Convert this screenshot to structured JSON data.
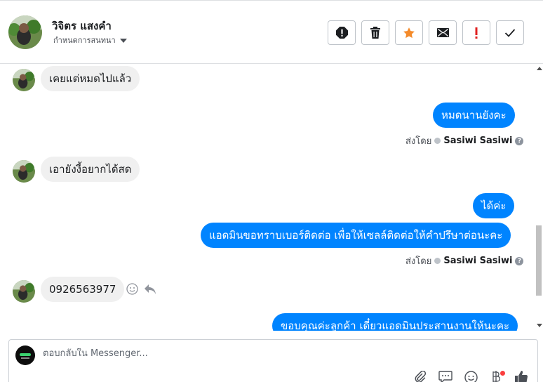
{
  "header": {
    "contact_name": "วิจิตร แสงคำ",
    "status_label": "กำหนดการสนทนา",
    "actions": [
      {
        "name": "spam",
        "icon": "report-icon"
      },
      {
        "name": "delete",
        "icon": "trash-icon"
      },
      {
        "name": "star",
        "icon": "star-icon",
        "color": "#f48a2a"
      },
      {
        "name": "mark-unread",
        "icon": "envelope-icon"
      },
      {
        "name": "follow-up",
        "icon": "exclamation-icon",
        "color": "#e02020"
      },
      {
        "name": "done",
        "icon": "check-icon"
      }
    ]
  },
  "messages": [
    {
      "direction": "in",
      "text": "เคยแต่หมดไปแล้ว"
    },
    {
      "direction": "out",
      "text": "หมดนานยังคะ"
    },
    {
      "direction": "meta",
      "prefix": "ส่งโดย",
      "agent": "Sasiwi Sasiwi"
    },
    {
      "direction": "in",
      "text": "เอายังงี้อยากได้สด"
    },
    {
      "direction": "out",
      "text": "ได้ค่ะ"
    },
    {
      "direction": "out",
      "text": "แอดมินขอทราบเบอร์ติดต่อ เพื่อให้เซลล์ติดต่อให้คำปรึษาต่อนะคะ"
    },
    {
      "direction": "meta",
      "prefix": "ส่งโดย",
      "agent": "Sasiwi Sasiwi"
    },
    {
      "direction": "in",
      "text": "0926563977"
    },
    {
      "direction": "out",
      "text": "ขอบคุณค่ะลูกค้า เดี๋ยวแอดมินประสานงานให้นะคะ"
    }
  ],
  "composer": {
    "placeholder": "ตอบกลับใน Messenger...",
    "value": ""
  },
  "colors": {
    "outgoing_bubble": "#0084ff",
    "incoming_bubble": "#f0f0f0",
    "notification_dot": "#fa3e3e"
  }
}
